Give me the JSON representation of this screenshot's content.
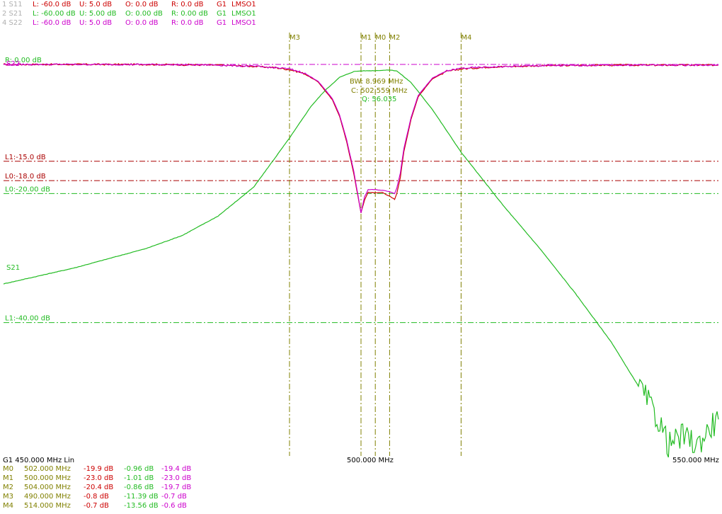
{
  "traces": [
    {
      "label": "1 S11",
      "L": "L: -60.0 dB",
      "U": "U:  5.0 dB",
      "O": "O:  0.0 dB",
      "R": "R:  0.0 dB",
      "G": "G1",
      "mode": "LMSO1",
      "color": "#cc0000"
    },
    {
      "label": "2 S21",
      "L": "L: -60.00 dB",
      "U": "U:  5.00 dB",
      "O": "O:  0.00 dB",
      "R": "R:  0.00 dB",
      "G": "G1",
      "mode": "LMSO1",
      "color": "#22bb22"
    },
    {
      "label": "4 S22",
      "L": "L: -60.0 dB",
      "U": "U:  5.0 dB",
      "O": "O:  0.0 dB",
      "R": "R:  0.0 dB",
      "G": "G1",
      "mode": "LMSO1",
      "color": "#cc00cc"
    }
  ],
  "colors": {
    "s11": "#cc0000",
    "s21": "#22bb22",
    "s22": "#cc00cc",
    "marker": "#808000",
    "limit_red": "#aa0000"
  },
  "chart_data": {
    "type": "line",
    "x_unit": "MHz",
    "xlim": [
      450,
      550
    ],
    "ylim": [
      -60,
      5
    ],
    "series": [
      {
        "name": "S11",
        "color": "#cc0000",
        "x": [
          450,
          460,
          470,
          480,
          485,
          488,
          490,
          492,
          494,
          496,
          497,
          498,
          499,
          500,
          500.5,
          501,
          502,
          503,
          503.5,
          504,
          504.7,
          505,
          505.5,
          506,
          507,
          508,
          510,
          512,
          514,
          518,
          525,
          535,
          550
        ],
        "y": [
          0,
          0,
          0,
          -0.1,
          -0.3,
          -0.5,
          -0.8,
          -1.4,
          -2.7,
          -5.5,
          -8.0,
          -12.0,
          -17.0,
          -23.0,
          -21.0,
          -19.8,
          -19.9,
          -19.8,
          -20.2,
          -20.4,
          -20.9,
          -20.0,
          -17.5,
          -13.5,
          -8.5,
          -5.0,
          -2.2,
          -1.1,
          -0.7,
          -0.4,
          -0.2,
          -0.1,
          -0.1
        ]
      },
      {
        "name": "S21",
        "color": "#22bb22",
        "x": [
          450,
          460,
          470,
          475,
          480,
          485,
          490,
          493,
          495,
          497,
          499,
          500,
          502,
          504,
          505,
          507,
          510,
          514,
          520,
          525,
          530,
          535,
          540,
          542,
          543,
          545,
          547,
          549,
          550
        ],
        "y": [
          -34,
          -31.5,
          -28.5,
          -26.5,
          -23.5,
          -19,
          -11.4,
          -6.5,
          -4,
          -2,
          -1.1,
          -1.0,
          -0.96,
          -0.86,
          -1.0,
          -2.8,
          -7.0,
          -13.6,
          -22,
          -28.5,
          -35.5,
          -43,
          -52,
          -56,
          -59,
          -57.5,
          -59,
          -56,
          -55
        ]
      },
      {
        "name": "S22",
        "color": "#cc00cc",
        "x": [
          450,
          460,
          470,
          480,
          485,
          488,
          490,
          492,
          494,
          496,
          497,
          498,
          499,
          500,
          500.5,
          501,
          502,
          503,
          503.5,
          504,
          504.7,
          505,
          505.5,
          506,
          507,
          508,
          510,
          512,
          514,
          518,
          525,
          535,
          550
        ],
        "y": [
          0,
          0,
          0,
          -0.1,
          -0.3,
          -0.5,
          -0.7,
          -1.3,
          -2.6,
          -5.3,
          -7.8,
          -11.7,
          -16.6,
          -23.0,
          -20.5,
          -19.4,
          -19.4,
          -19.5,
          -19.6,
          -19.7,
          -20.0,
          -19.2,
          -16.8,
          -13.0,
          -8.2,
          -4.8,
          -2.1,
          -1.0,
          -0.6,
          -0.4,
          -0.2,
          -0.1,
          -0.1
        ]
      }
    ],
    "limit_lines": [
      {
        "label": "L1:-15.0 dB",
        "value": -15,
        "color": "#aa0000"
      },
      {
        "label": "L0:-18.0 dB",
        "value": -18,
        "color": "#aa0000"
      },
      {
        "label": "L0:-20.00 dB",
        "value": -20,
        "color": "#22bb22"
      },
      {
        "label": "L1:-40.00 dB",
        "value": -40,
        "color": "#22bb22"
      }
    ],
    "ref_label_top": "R: 0.00 dB",
    "ref_label_s22": "S22",
    "s21_label": "S21",
    "markers": [
      {
        "name": "M3",
        "x": 490
      },
      {
        "name": "M1",
        "x": 500
      },
      {
        "name": "M0",
        "x": 502
      },
      {
        "name": "M2",
        "x": 504
      },
      {
        "name": "M4",
        "x": 514
      }
    ],
    "bw_info": {
      "bw": "BW:  8.969 MHz",
      "c": "C: 502.559 MHz",
      "q": "Q: 56.035"
    },
    "x_labels": {
      "start": "G1    450.000 MHz    Lin",
      "center": "500.000 MHz",
      "stop": "550.000 MHz"
    }
  },
  "marker_table": [
    {
      "name": "M0",
      "freq": "502.000 MHz",
      "s11": "-19.9 dB",
      "s21": "-0.96 dB",
      "s22": "-19.4 dB"
    },
    {
      "name": "M1",
      "freq": "500.000 MHz",
      "s11": "-23.0 dB",
      "s21": "-1.01 dB",
      "s22": "-23.0 dB"
    },
    {
      "name": "M2",
      "freq": "504.000 MHz",
      "s11": "-20.4 dB",
      "s21": "-0.86 dB",
      "s22": "-19.7 dB"
    },
    {
      "name": "M3",
      "freq": "490.000 MHz",
      "s11": "-0.8 dB",
      "s21": "-11.39 dB",
      "s22": "-0.7 dB"
    },
    {
      "name": "M4",
      "freq": "514.000 MHz",
      "s11": "-0.7 dB",
      "s21": "-13.56 dB",
      "s22": "-0.6 dB"
    }
  ]
}
